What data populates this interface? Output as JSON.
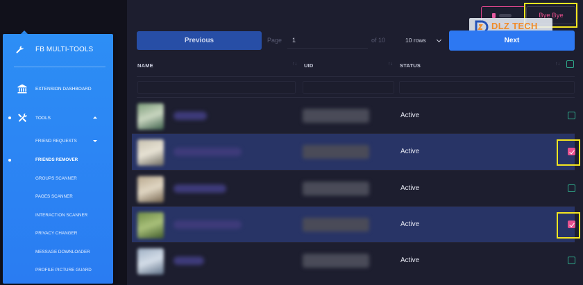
{
  "sidebar": {
    "brand": "FB MULTI-TOOLS",
    "dashboard_label": "EXTENSION DASHBOARD",
    "tools_label": "TOOLS",
    "items": [
      {
        "label": "FRIEND REQUESTS"
      },
      {
        "label": "FRIENDS REMOVER"
      },
      {
        "label": "GROUPS SCANNER"
      },
      {
        "label": "PAGES SCANNER"
      },
      {
        "label": "INTERACTION SCANNER"
      },
      {
        "label": "PRIVACY CHANGER"
      },
      {
        "label": "MESSAGE DOWNLOADER"
      },
      {
        "label": "PROFILE PICTURE GUARD"
      }
    ],
    "active_item": "FRIENDS REMOVER"
  },
  "toolbar": {
    "previous_label": "Previous",
    "page_label": "Page",
    "page_value": "1",
    "of_label": "of 10",
    "rows_value": "10 rows",
    "next_label": "Next"
  },
  "top_actions": {
    "bye_label": "Bye Bye"
  },
  "watermark": {
    "text": "DLZ TECH"
  },
  "table": {
    "columns": [
      "NAME",
      "UID",
      "STATUS"
    ],
    "rows": [
      {
        "status": "Active",
        "selected": false
      },
      {
        "status": "Active",
        "selected": true
      },
      {
        "status": "Active",
        "selected": false
      },
      {
        "status": "Active",
        "selected": true
      },
      {
        "status": "Active",
        "selected": false
      }
    ]
  },
  "colors": {
    "sidebar": "#2d8ef5",
    "accent_button": "#2d78f2",
    "selected_row": "#283466",
    "checkbox_checked": "#e6518f",
    "highlight": "#f5e620"
  }
}
